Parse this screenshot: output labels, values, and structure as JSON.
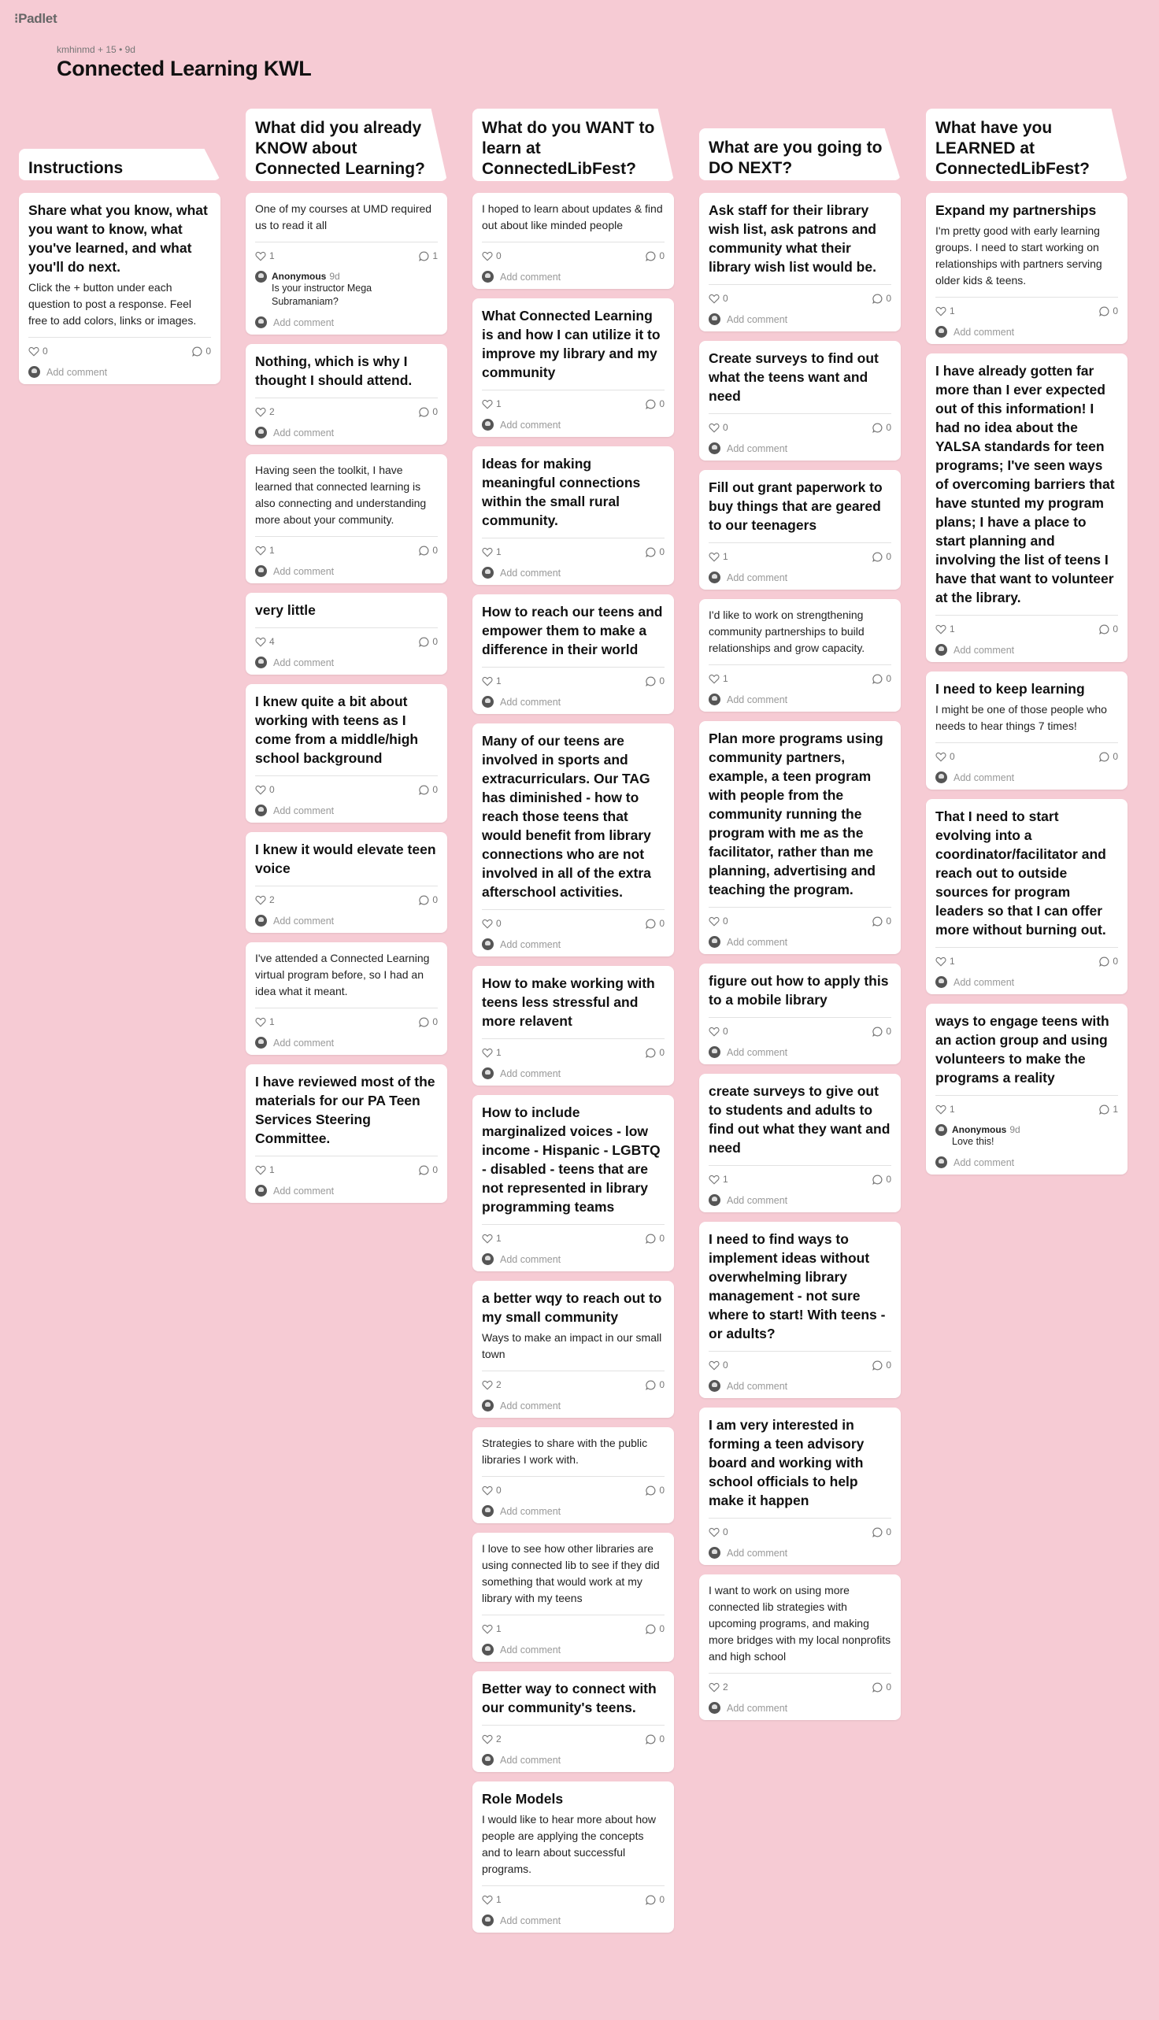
{
  "app": {
    "logo": "⁝Padlet"
  },
  "header": {
    "author": "kmhinmd",
    "contributors": "+ 15",
    "age": "• 9d",
    "title": "Connected Learning KWL"
  },
  "labels": {
    "add_comment": "Add comment"
  },
  "columns": [
    {
      "title": "Instructions",
      "cards": [
        {
          "title": "Share what you know, what you want to know, what you've learned, and what you'll do next.",
          "body": "Click the + button under each question to post a response. Feel free to add colors, links or images.",
          "likes": "0",
          "comments": "0"
        }
      ]
    },
    {
      "title": "What did you already KNOW about Connected Learning?",
      "cards": [
        {
          "title": "",
          "body": "One of my courses at UMD required us to read it all",
          "likes": "1",
          "comments": "1",
          "comment": {
            "author": "Anonymous",
            "time": "9d",
            "text": "Is your instructor Mega Subramaniam?"
          }
        },
        {
          "title": "Nothing, which is why I thought I should attend.",
          "body": "",
          "likes": "2",
          "comments": "0"
        },
        {
          "title": "",
          "body": "Having seen the toolkit, I have learned that connected learning is also connecting and understanding more about your community.",
          "likes": "1",
          "comments": "0"
        },
        {
          "title": "very little",
          "body": "",
          "likes": "4",
          "comments": "0"
        },
        {
          "title": "I knew quite a bit about working with teens as I come from a middle/high school background",
          "body": "",
          "likes": "0",
          "comments": "0"
        },
        {
          "title": "I knew it would elevate teen voice",
          "body": "",
          "likes": "2",
          "comments": "0"
        },
        {
          "title": "",
          "body": "I've attended a Connected Learning virtual program before, so I had an idea what it meant.",
          "likes": "1",
          "comments": "0"
        },
        {
          "title": "I have reviewed most of the materials for our PA Teen Services Steering Committee.",
          "body": "",
          "likes": "1",
          "comments": "0"
        }
      ]
    },
    {
      "title": "What do you WANT to learn at ConnectedLibFest?",
      "cards": [
        {
          "title": "",
          "body": "I hoped to learn about updates & find out about like minded people",
          "likes": "0",
          "comments": "0"
        },
        {
          "title": "What Connected Learning is and how I can utilize it to improve my library and my community",
          "body": "",
          "likes": "1",
          "comments": "0"
        },
        {
          "title": "Ideas for making meaningful connections within the small rural community.",
          "body": "",
          "likes": "1",
          "comments": "0"
        },
        {
          "title": "How to reach our teens and empower them to make a difference in their world",
          "body": "",
          "likes": "1",
          "comments": "0"
        },
        {
          "title": "Many of our teens are involved in sports and extracurriculars. Our TAG has diminished - how to reach those teens that would benefit from library connections who are not involved in all of the extra afterschool activities.",
          "body": "",
          "likes": "0",
          "comments": "0"
        },
        {
          "title": "How to make working with teens less stressful and more relavent",
          "body": "",
          "likes": "1",
          "comments": "0"
        },
        {
          "title": "How to include marginalized voices - low income - Hispanic - LGBTQ - disabled - teens that are not represented in library programming teams",
          "body": "",
          "likes": "1",
          "comments": "0"
        },
        {
          "title": "a better wqy to reach out to my small community",
          "body": "Ways to make an impact in our small town",
          "likes": "2",
          "comments": "0"
        },
        {
          "title": "",
          "body": "Strategies to share with the public libraries I work with.",
          "likes": "0",
          "comments": "0"
        },
        {
          "title": "",
          "body": "I love to see how other libraries are using connected lib to see if they did something that would work at my library with my teens",
          "likes": "1",
          "comments": "0"
        },
        {
          "title": "Better way to connect with our community's teens.",
          "body": "",
          "likes": "2",
          "comments": "0"
        },
        {
          "title": "Role Models",
          "body": "I would like to hear more about how people are applying the concepts and to learn about successful programs.",
          "likes": "1",
          "comments": "0"
        }
      ]
    },
    {
      "title": "What are you going to DO NEXT?",
      "cards": [
        {
          "title": "Ask staff for their library wish list, ask patrons and community what their library wish list would be.",
          "body": "",
          "likes": "0",
          "comments": "0"
        },
        {
          "title": "Create surveys to find out what the teens want and need",
          "body": "",
          "likes": "0",
          "comments": "0"
        },
        {
          "title": "Fill out grant paperwork to buy things that are geared to our teenagers",
          "body": "",
          "likes": "1",
          "comments": "0"
        },
        {
          "title": "",
          "body": "I'd like to work on strengthening community partnerships to build relationships and grow capacity.",
          "likes": "1",
          "comments": "0"
        },
        {
          "title": "Plan more programs using community partners, example, a teen program with people from the community running the program with me as the facilitator, rather than me planning, advertising and teaching the program.",
          "body": "",
          "likes": "0",
          "comments": "0"
        },
        {
          "title": "figure out how to apply this to a mobile library",
          "body": "",
          "likes": "0",
          "comments": "0"
        },
        {
          "title": "create surveys to give out to students and adults to find out what they want and need",
          "body": "",
          "likes": "1",
          "comments": "0"
        },
        {
          "title": "I need to find ways to implement ideas without overwhelming library management - not sure where to start! With teens - or adults?",
          "body": "",
          "likes": "0",
          "comments": "0"
        },
        {
          "title": "I am very interested in forming a teen advisory board and working with school officials to help make it happen",
          "body": "",
          "likes": "0",
          "comments": "0"
        },
        {
          "title": "",
          "body": "I want to work on using more connected lib strategies with upcoming programs, and making more bridges with my local nonprofits and high school",
          "likes": "2",
          "comments": "0"
        }
      ]
    },
    {
      "title": "What have you LEARNED at ConnectedLibFest?",
      "cards": [
        {
          "title": "Expand my partnerships",
          "body": "I'm pretty good with early learning groups. I need to start working on relationships with partners serving older kids & teens.",
          "likes": "1",
          "comments": "0"
        },
        {
          "title": "I have already gotten far more than I ever expected out of this information! I had no idea about the YALSA standards for teen programs; I've seen ways of overcoming barriers that have stunted my program plans; I have a place to start planning and involving the list of teens I have that want to volunteer at the library.",
          "body": "",
          "likes": "1",
          "comments": "0"
        },
        {
          "title": "I need to keep learning",
          "body": "I might be one of those people who needs to hear things 7 times!",
          "likes": "0",
          "comments": "0"
        },
        {
          "title": "That I need to start evolving into a coordinator/facilitator and reach out to outside sources for program leaders so that I can offer more without burning out.",
          "body": "",
          "likes": "1",
          "comments": "0"
        },
        {
          "title": "ways to engage teens with an action group and using volunteers to make the programs a reality",
          "body": "",
          "likes": "1",
          "comments": "1",
          "comment": {
            "author": "Anonymous",
            "time": "9d",
            "text": "Love this!"
          }
        }
      ]
    }
  ]
}
